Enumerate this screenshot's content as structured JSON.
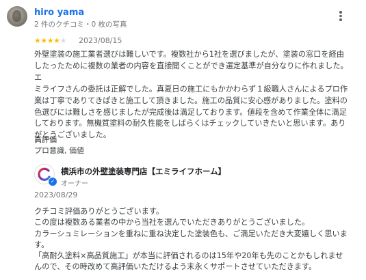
{
  "review": {
    "reviewer_name": "hiro yama",
    "reviewer_meta": "2 件のクチコミ・0 枚の写真",
    "rating": 4,
    "max_rating": 5,
    "date": "2023/08/15",
    "body_lines": [
      "外壁塗装の施工業者選びは難しいです。複数社から1社を選びましたが、塗装の窓口を経由",
      "したったために複数の業者の内容を直接聞くことができ選定基準が自分なりに作れました。エ",
      "ミライフさんの委託は正解でした。真夏日の施工にもかかわらず１級職人さんによるプロ作",
      "業は丁寧でありてきぱきと施工して頂きました。施工の品質に安心感がありました。塗料の",
      "色選びには難しさを感じましたが完成後は満足しております。値段を含めて作業全体に満足",
      "しております。無機質塗料の耐久性能をしばらくはチェックしていきたいと思います。あり",
      "がとうございました。"
    ],
    "tag_label": "高評価",
    "tag_value": "プロ意識, 価値"
  },
  "owner_reply": {
    "owner_name": "横浜市の外壁塗装専門店【エミライフホーム】",
    "role": "オーナー",
    "date": "2023/08/29",
    "body_lines": [
      "クチコミ評価ありがとうございます。",
      "この度は複数ある業者の中から当社を選んでいただきありがとうございました。",
      "カラーシュミレーションを重ねに重ね決定した塗装色も、ご満足いただき大変嬉しく思いま",
      "す。",
      "「高耐久塗料×高品質施工」が本当に評価されるのは15年や20年も先のことかもしれませ",
      "んので、その時改めて高評価いただけるよう末永くサポートさせていただきます。"
    ]
  },
  "icons": {
    "more": "more-vert-icon",
    "star": "star-icon",
    "verified": "verified-check-icon",
    "logo": "emilife-home-logo"
  },
  "colors": {
    "name_link": "#1a73e8",
    "star": "#fbbc04",
    "star_empty": "#dadce0",
    "meta": "#70757a",
    "verified": "#1a73e8"
  }
}
